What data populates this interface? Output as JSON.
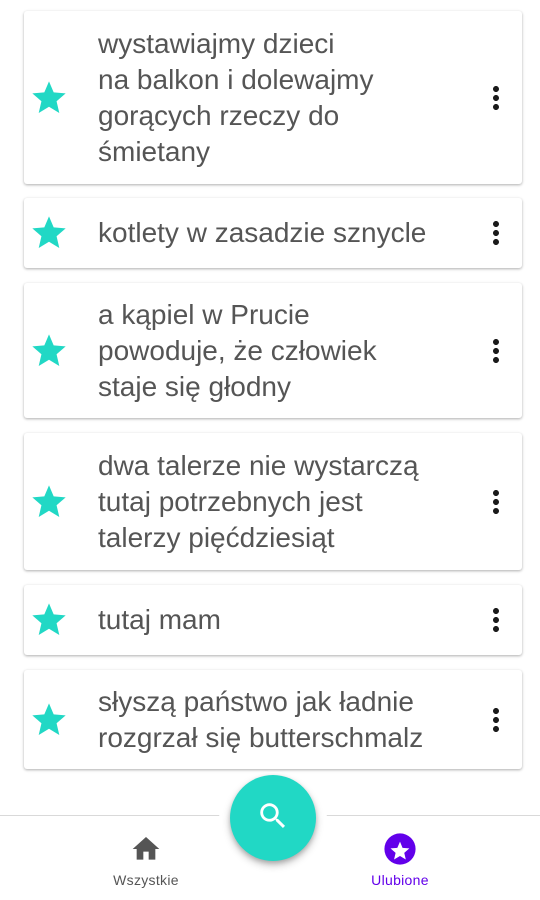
{
  "colors": {
    "accent": "#21d8c5",
    "text": "#555555",
    "active_tab": "#6200ea",
    "inactive_tab": "#555555",
    "more_icon": "#1a1a1a"
  },
  "items": [
    {
      "text": "wystawiajmy dzieci\nna balkon i dolewajmy\ngorących rzeczy do\nśmietany",
      "favorite": true,
      "star_icon": "star-icon",
      "more_icon": "more-vert-icon"
    },
    {
      "text": "kotlety w zasadzie sznycle",
      "favorite": true,
      "star_icon": "star-icon",
      "more_icon": "more-vert-icon"
    },
    {
      "text": "a kąpiel w Prucie\npowoduje, że człowiek\nstaje się głodny",
      "favorite": true,
      "star_icon": "star-icon",
      "more_icon": "more-vert-icon"
    },
    {
      "text": "dwa talerze nie wystarczą\ntutaj potrzebnych jest\ntalerzy pięćdziesiąt",
      "favorite": true,
      "star_icon": "star-icon",
      "more_icon": "more-vert-icon"
    },
    {
      "text": "tutaj mam",
      "favorite": true,
      "star_icon": "star-icon",
      "more_icon": "more-vert-icon"
    },
    {
      "text": "słyszą państwo jak ładnie\nrozgrzał się butterschmalz",
      "favorite": true,
      "star_icon": "star-icon",
      "more_icon": "more-vert-icon"
    }
  ],
  "bottom_nav": {
    "tabs": [
      {
        "label": "Wszystkie",
        "icon": "home-icon",
        "active": false
      },
      {
        "label": "Ulubione",
        "icon": "star-circle-icon",
        "active": true
      }
    ]
  },
  "fab": {
    "icon": "search-icon"
  }
}
